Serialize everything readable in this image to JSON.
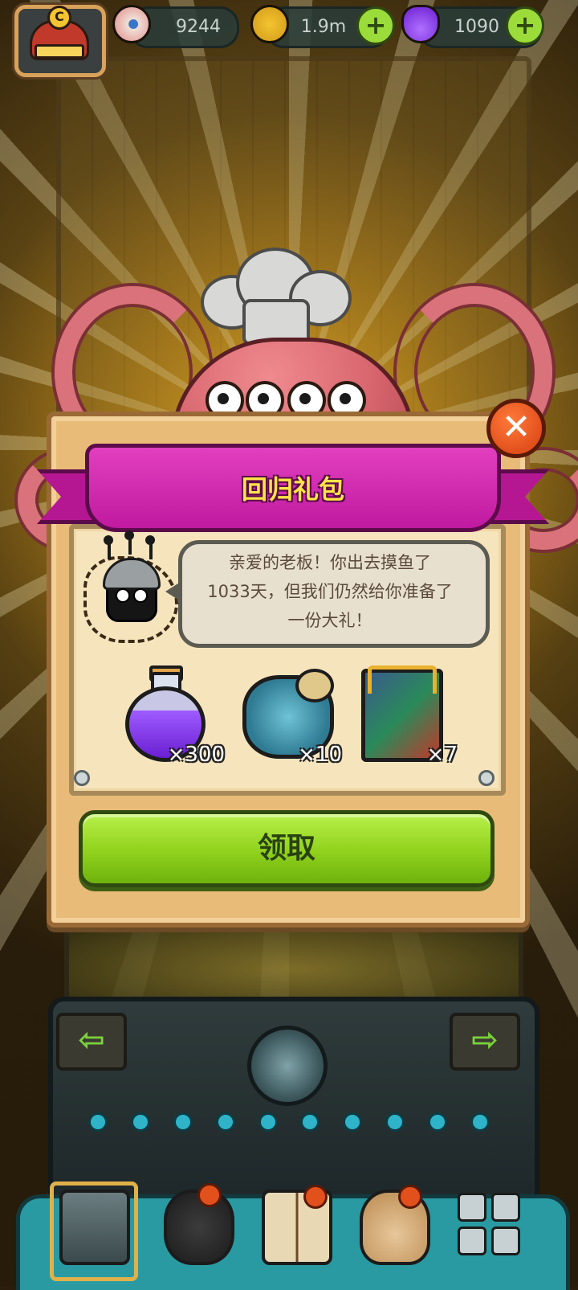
{
  "top_bar": {
    "logo_letter": "C",
    "resources": [
      {
        "name": "eyeball",
        "icon": "eyeball-icon",
        "value": "9244",
        "has_plus": false
      },
      {
        "name": "coin",
        "icon": "coin-icon",
        "value": "1.9m",
        "has_plus": true
      },
      {
        "name": "potion",
        "icon": "potion-icon",
        "value": "1090",
        "has_plus": true
      }
    ],
    "plus_symbol": "+"
  },
  "dialog": {
    "title": "回归礼包",
    "close_symbol": "✕",
    "message_line1": "亲爱的老板！你出去摸鱼了",
    "message_line2": "1033天，但我们仍然给你准备了",
    "message_line3": "一份大礼！",
    "rewards": [
      {
        "icon": "purple-potion-icon",
        "count": "×300"
      },
      {
        "icon": "blueprint-scroll-icon",
        "count": "×10"
      },
      {
        "icon": "treasure-book-icon",
        "count": "×7"
      }
    ],
    "claim_label": "领取"
  },
  "background": {
    "left_arrow": "⇦",
    "right_arrow": "⇨"
  },
  "colors": {
    "ribbon": "#c01aa0",
    "title_text": "#ffe34a",
    "claim_button": "#8fd11c",
    "nav_bar": "#2a9aa2"
  }
}
